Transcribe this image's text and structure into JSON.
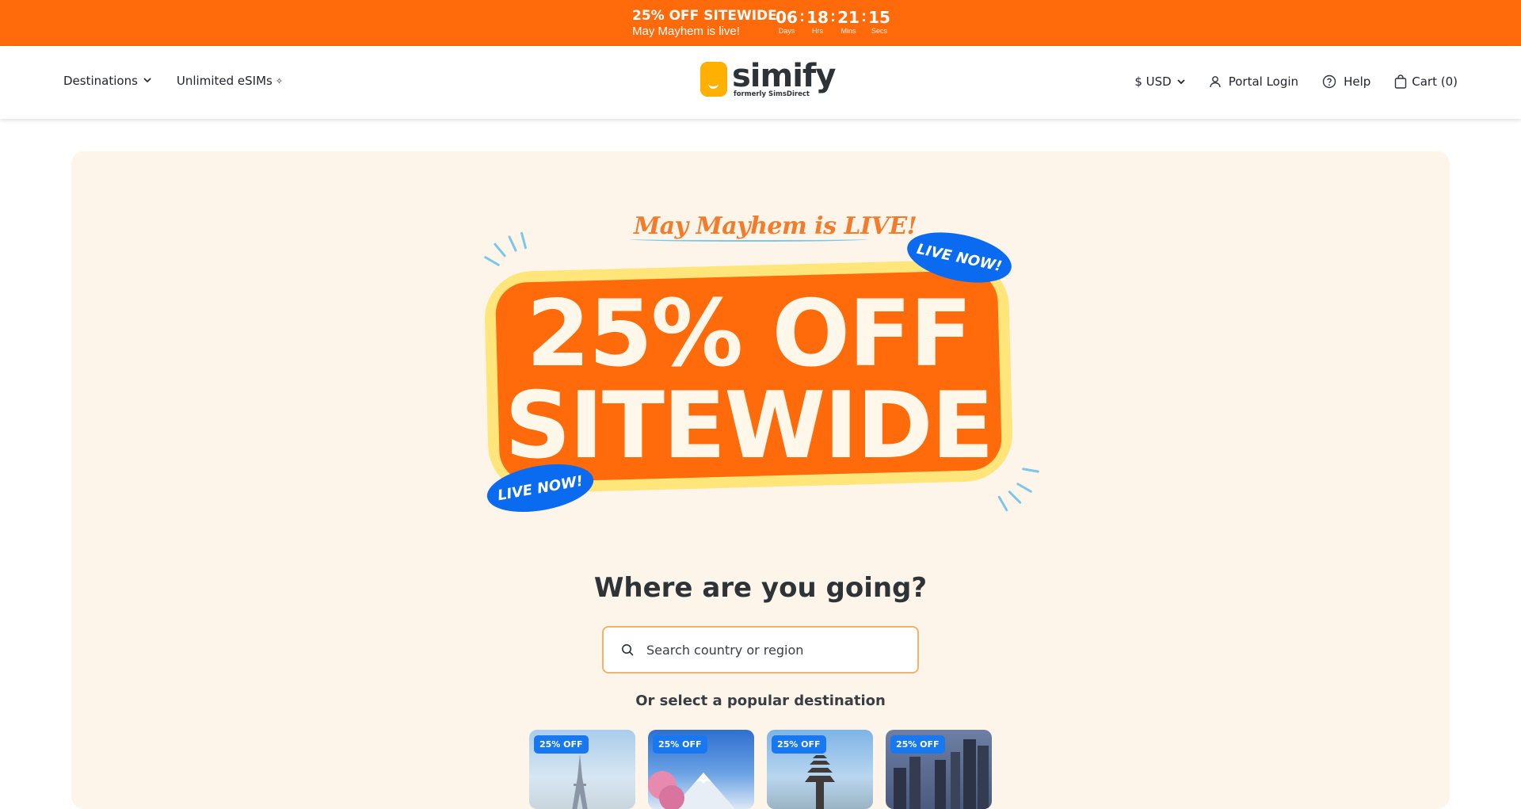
{
  "promo": {
    "title": "25% OFF SITEWIDE",
    "subtitle": "May Mayhem is live!",
    "countdown": [
      {
        "value": "06",
        "label": "Days"
      },
      {
        "value": "18",
        "label": "Hrs"
      },
      {
        "value": "21",
        "label": "Mins"
      },
      {
        "value": "15",
        "label": "Secs"
      }
    ]
  },
  "header": {
    "nav_left": [
      {
        "label": "Destinations"
      },
      {
        "label": "Unlimited eSIMs"
      }
    ],
    "logo": {
      "name": "simify",
      "tagline": "formerly SimsDirect"
    },
    "currency": "$ USD",
    "portal_login": "Portal Login",
    "help": "Help",
    "cart": "Cart (0)"
  },
  "hero": {
    "kicker": "May Mayhem is LIVE!",
    "headline_line1": "25% OFF",
    "headline_line2": "SITEWIDE",
    "sticker_text": "LIVE NOW!",
    "question": "Where are you going?",
    "search_placeholder": "Search country or region",
    "popular_label": "Or select a popular destination",
    "destinations": [
      {
        "badge": "25% OFF",
        "icon": "eiffel-tower"
      },
      {
        "badge": "25% OFF",
        "icon": "mount-fuji"
      },
      {
        "badge": "25% OFF",
        "icon": "bali-temple"
      },
      {
        "badge": "25% OFF",
        "icon": "city-skyline"
      }
    ]
  },
  "colors": {
    "brand_orange": "#ff6a0a",
    "hero_bg": "#fdf5e9",
    "badge_blue": "#1778f2",
    "logo_yellow": "#ffb000"
  }
}
